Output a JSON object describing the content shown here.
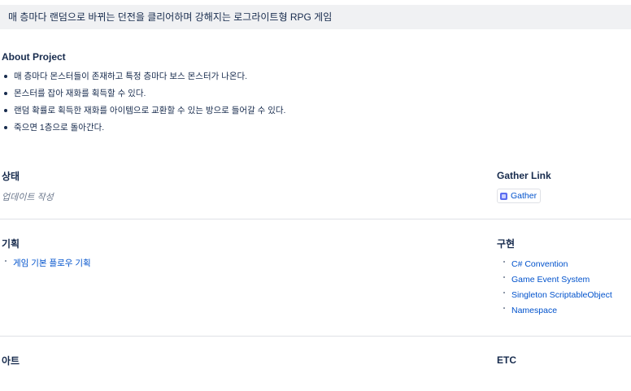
{
  "banner": {
    "text": "매 층마다 랜덤으로 바뀌는 던전을 클리어하며 강해지는 로그라이트형 RPG 게임"
  },
  "about": {
    "heading": "About Project",
    "items": [
      "매 층마다 몬스터들이 존재하고 특정 층마다 보스 몬스터가 나온다.",
      "몬스터를 잡아 재화를 획득할 수 있다.",
      "랜덤 확률로 획득한 재화를 아이템으로 교환할 수 있는 방으로 들어갈 수 있다.",
      "죽으면 1층으로 돌아간다."
    ]
  },
  "status": {
    "title": "상태",
    "value": "업데이트 작성"
  },
  "gather": {
    "title": "Gather Link",
    "link_label": "Gather",
    "icon": "gather-logo-icon"
  },
  "planning": {
    "title": "기획",
    "links": [
      "게임 기본 플로우 기획"
    ]
  },
  "implementation": {
    "title": "구현",
    "links": [
      "C# Convention",
      "Game Event System",
      "Singleton ScriptableObject",
      "Namespace"
    ]
  },
  "art": {
    "title": "아트"
  },
  "etc": {
    "title": "ETC"
  },
  "colors": {
    "link": "#0052cc",
    "text": "#172b4d",
    "banner_bg": "#f0f1f3",
    "divider": "#dfe1e6"
  }
}
